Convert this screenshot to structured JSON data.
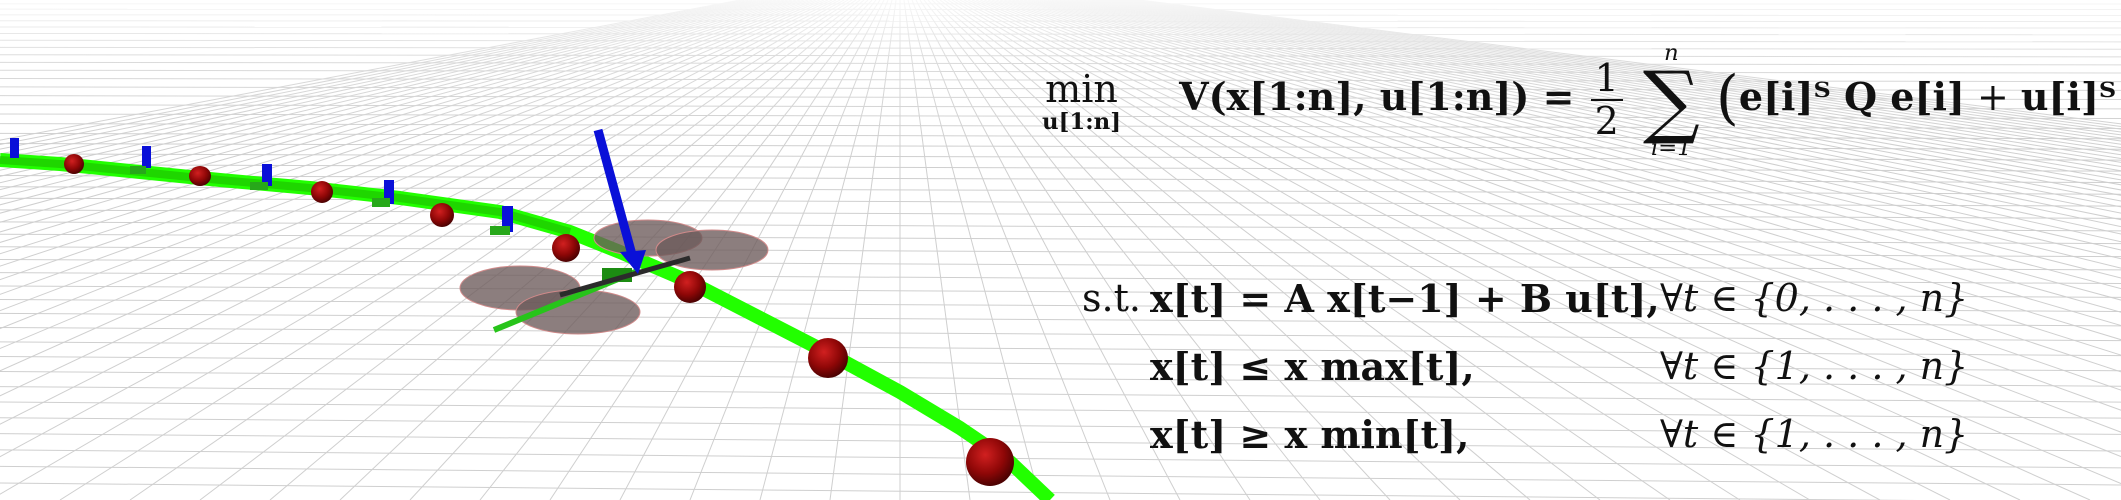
{
  "objective": {
    "min_label": "min",
    "min_sub": "u[1:n]",
    "lhs": "V(x[1:n], u[1:n]) =",
    "frac_num": "1",
    "frac_den": "2",
    "sum_top": "n",
    "sum_bottom": "i=1",
    "term1": "e[i]ᵀ Q e[i]",
    "term2": "u[i]ᵀ P u[i]"
  },
  "constraints": {
    "st_label": "s.t.",
    "rows": [
      {
        "lhs": "x[t] = A x[t−1] + B u[t],",
        "domain": "∀t ∈ {0, . . . , n}"
      },
      {
        "lhs": "x[t] ≤ x max[t],",
        "domain": "∀t ∈ {1, . . . , n}"
      },
      {
        "lhs": "x[t] ≥ x min[t],",
        "domain": "∀t ∈ {1, . . . , n}"
      }
    ]
  },
  "scene": {
    "path_color": "#22ff00",
    "waypoint_color": "#a30b0b",
    "arrow_color": "#0a10d8",
    "rotor_color": "#6b5a5a",
    "grid_color": "#c9c9c9"
  }
}
